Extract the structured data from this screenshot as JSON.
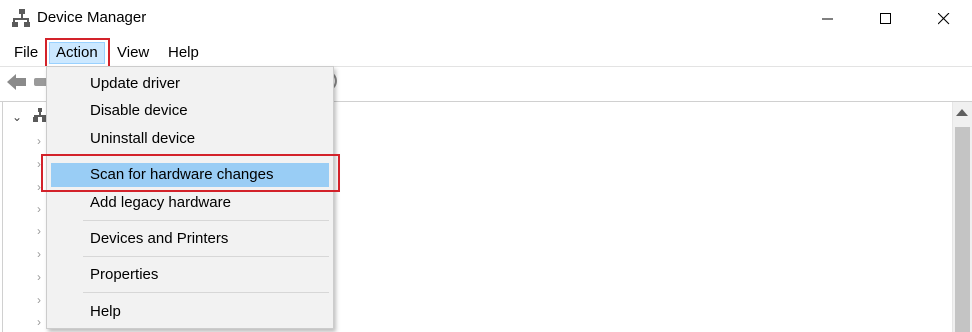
{
  "window": {
    "title": "Device Manager",
    "controls": {
      "minimize": "minimize-icon",
      "maximize": "maximize-icon",
      "close": "close-icon"
    }
  },
  "menubar": {
    "items": [
      {
        "label": "File"
      },
      {
        "label": "Action",
        "active": true
      },
      {
        "label": "View"
      },
      {
        "label": "Help"
      }
    ]
  },
  "action_menu": {
    "items": [
      {
        "label": "Update driver"
      },
      {
        "label": "Disable device"
      },
      {
        "label": "Uninstall device"
      },
      {
        "label": "Scan for hardware changes",
        "selected": true
      },
      {
        "label": "Add legacy hardware"
      },
      {
        "label": "Devices and Printers"
      },
      {
        "label": "Properties"
      },
      {
        "label": "Help"
      }
    ]
  },
  "colors": {
    "highlight_border": "#d3222a",
    "selected_item": "#99cdf5",
    "active_menu": "#cce8ff",
    "menu_background": "#f2f2f2"
  }
}
